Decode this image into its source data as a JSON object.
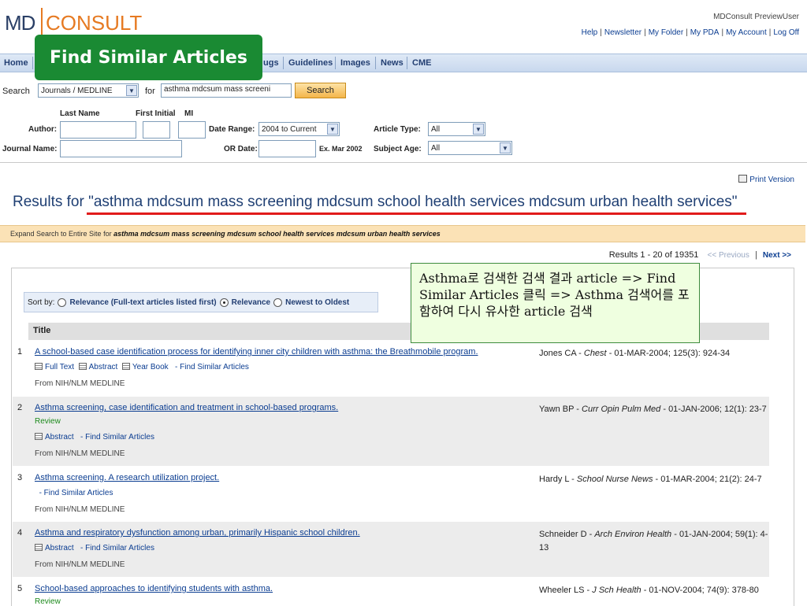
{
  "header": {
    "logo_md": "MD",
    "logo_consult": "CONSULT",
    "user": "MDConsult PreviewUser",
    "links": [
      "Help",
      "Newsletter",
      "My Folder",
      "My PDA",
      "My Account",
      "Log Off"
    ]
  },
  "nav": {
    "items": [
      "Home",
      "ugs",
      "Guidelines",
      "Images",
      "News",
      "CME"
    ]
  },
  "callout": "Find Similar Articles",
  "search": {
    "label": "Search",
    "scope": "Journals / MEDLINE",
    "for_label": "for",
    "query": "asthma mdcsum mass screeni",
    "button": "Search"
  },
  "advanced": {
    "last_name_label": "Last Name",
    "first_initial_label": "First Initial",
    "mi_label": "MI",
    "author_label": "Author:",
    "journal_label": "Journal Name:",
    "date_range_label": "Date Range:",
    "date_range_value": "2004 to Current",
    "or_date_label": "OR Date:",
    "date_example": "Ex. Mar 2002",
    "article_type_label": "Article Type:",
    "article_type_value": "All",
    "subject_age_label": "Subject Age:",
    "subject_age_value": "All"
  },
  "print_version": "Print Version",
  "results_title": "Results for \"asthma mdcsum mass screening mdcsum school health services mdcsum urban health services\"",
  "expand": {
    "prefix": "Expand Search to Entire Site for",
    "query": "asthma mdcsum mass screening mdcsum school health services mdcsum urban health services"
  },
  "pager": {
    "count": "Results 1 - 20 of 19351",
    "previous": "<< Previous",
    "next": "Next >>"
  },
  "sort": {
    "label": "Sort by:",
    "options": [
      "Relevance (Full-text articles listed first)",
      "Relevance",
      "Newest to Oldest"
    ],
    "selected": "Relevance"
  },
  "table_header": "Title",
  "annotation": "Asthma로 검색한 검색 결과 article => Find Similar Articles 클릭 => Asthma 검색어를 포함하여 다시 유사한 article 검색",
  "results": [
    {
      "num": "1",
      "title": "A school-based case identification process for identifying inner city children with asthma: the Breathmobile program.",
      "links": [
        "Full Text",
        "Abstract",
        "Year Book",
        "- Find Similar Articles"
      ],
      "source": "From NIH/NLM MEDLINE",
      "author": "Jones CA -",
      "journal": "Chest",
      "citation": "- 01-MAR-2004; 125(3): 924-34"
    },
    {
      "num": "2",
      "title": "Asthma screening, case identification and treatment in school-based programs.",
      "review": "Review",
      "links": [
        "Abstract",
        "- Find Similar Articles"
      ],
      "source": "From NIH/NLM MEDLINE",
      "author": "Yawn BP -",
      "journal": "Curr Opin Pulm Med",
      "citation": "- 01-JAN-2006; 12(1): 23-7"
    },
    {
      "num": "3",
      "title": "Asthma screening. A research utilization project.",
      "links": [
        "- Find Similar Articles"
      ],
      "source": "From NIH/NLM MEDLINE",
      "author": "Hardy L -",
      "journal": "School Nurse News",
      "citation": "- 01-MAR-2004; 21(2): 24-7"
    },
    {
      "num": "4",
      "title": "Asthma and respiratory dysfunction among urban, primarily Hispanic school children.",
      "links": [
        "Abstract",
        "- Find Similar Articles"
      ],
      "source": "From NIH/NLM MEDLINE",
      "author": "Schneider D -",
      "journal": "Arch Environ Health",
      "citation": "- 01-JAN-2004; 59(1): 4-13"
    },
    {
      "num": "5",
      "title": "School-based approaches to identifying students with asthma.",
      "review": "Review",
      "author": "Wheeler LS -",
      "journal": "J Sch Health",
      "citation": "- 01-NOV-2004; 74(9): 378-80"
    }
  ]
}
